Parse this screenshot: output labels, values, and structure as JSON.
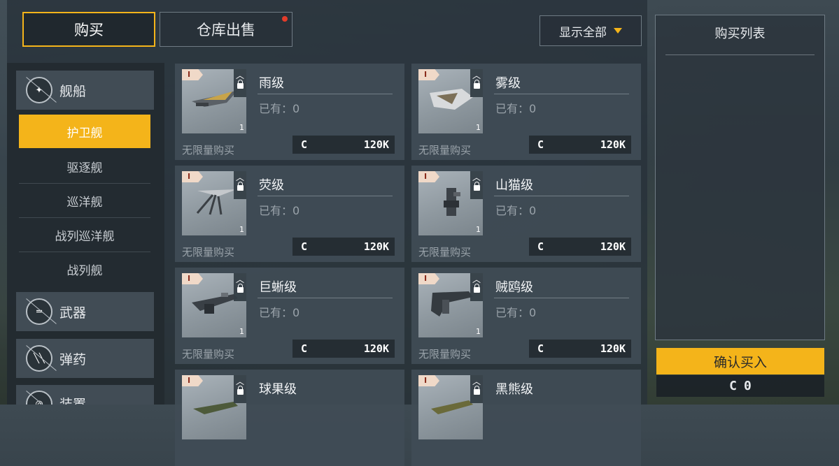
{
  "tabs": {
    "buy": "购买",
    "sell": "仓库出售"
  },
  "filter": {
    "label": "显示全部"
  },
  "sidebar": {
    "ships": "舰船",
    "subcategories": [
      "护卫舰",
      "驱逐舰",
      "巡洋舰",
      "战列巡洋舰",
      "战列舰"
    ],
    "weapons": "武器",
    "ammo": "弹药",
    "equipment": "装置"
  },
  "cards": [
    {
      "name": "雨级",
      "owned": "已有：0",
      "unlimited": "无限量购买",
      "currency": "C",
      "price": "120K",
      "tier": "I",
      "qty": "1"
    },
    {
      "name": "雾级",
      "owned": "已有：0",
      "unlimited": "无限量购买",
      "currency": "C",
      "price": "120K",
      "tier": "I",
      "qty": "1"
    },
    {
      "name": "荧级",
      "owned": "已有：0",
      "unlimited": "无限量购买",
      "currency": "C",
      "price": "120K",
      "tier": "I",
      "qty": "1"
    },
    {
      "name": "山猫级",
      "owned": "已有：0",
      "unlimited": "无限量购买",
      "currency": "C",
      "price": "120K",
      "tier": "I",
      "qty": "1"
    },
    {
      "name": "巨蜥级",
      "owned": "已有：0",
      "unlimited": "无限量购买",
      "currency": "C",
      "price": "120K",
      "tier": "I",
      "qty": "1"
    },
    {
      "name": "贼鸥级",
      "owned": "已有：0",
      "unlimited": "无限量购买",
      "currency": "C",
      "price": "120K",
      "tier": "I",
      "qty": "1"
    },
    {
      "name": "球果级",
      "owned": "",
      "unlimited": "",
      "currency": "",
      "price": "",
      "tier": "I",
      "qty": ""
    },
    {
      "name": "黑熊级",
      "owned": "",
      "unlimited": "",
      "currency": "",
      "price": "",
      "tier": "I",
      "qty": ""
    }
  ],
  "cart": {
    "title": "购买列表",
    "confirm": "确认买入",
    "currency": "C",
    "total": "0"
  },
  "colors": {
    "accent": "#f4b41a",
    "notification": "#e33c2a",
    "tier_badge_text": "#8b2d1d"
  }
}
